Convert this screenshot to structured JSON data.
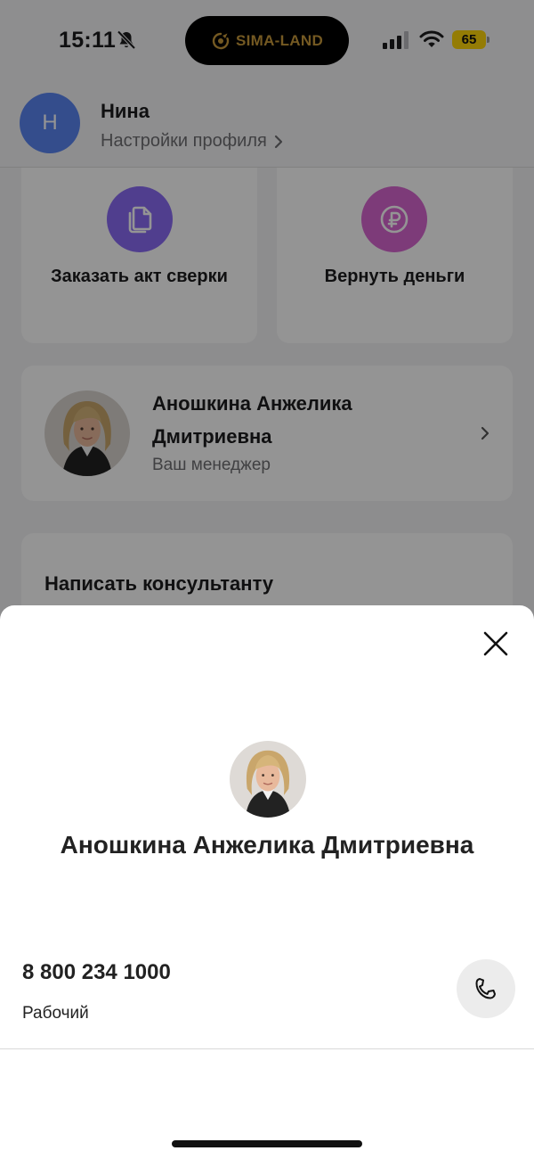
{
  "status_bar": {
    "time": "15:11",
    "battery": "65",
    "island_brand": "SIMA-LAND",
    "icons": [
      "bell-slash-icon",
      "signal-icon",
      "wifi-icon",
      "battery-icon"
    ]
  },
  "header": {
    "avatar_letter": "Н",
    "name": "Нина",
    "settings_link": "Настройки профиля"
  },
  "actions": [
    {
      "label": "Заказать акт сверки",
      "icon": "documents-icon",
      "color": "#8b6cf5"
    },
    {
      "label": "Вернуть деньги",
      "icon": "ruble-icon",
      "color": "#d766d0"
    }
  ],
  "manager": {
    "name": "Аношкина Анжелика Дмитриевна",
    "role": "Ваш менеджер"
  },
  "consultant": {
    "title": "Написать консультанту"
  },
  "sheet": {
    "name": "Аношкина Анжелика Дмитриевна",
    "phone": "8 800 234 1000",
    "phone_type": "Рабочий"
  },
  "colors": {
    "avatar": "#5b86f2",
    "battery": "#ffd60a",
    "brand": "#c89a3c"
  }
}
